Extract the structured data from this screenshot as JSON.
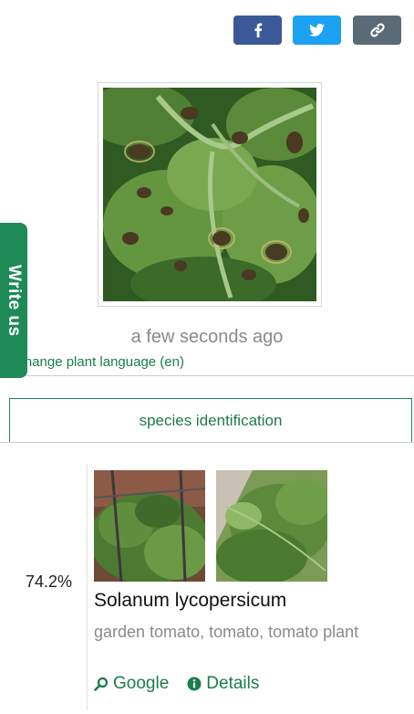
{
  "share": {
    "facebook_icon": "facebook-icon",
    "twitter_icon": "twitter-icon",
    "link_icon": "link-icon"
  },
  "observation": {
    "timestamp": "a few seconds ago",
    "change_language": "Change plant language (en)"
  },
  "feedback_tab": {
    "label": "Write us"
  },
  "tabs": {
    "species_identification": "species identification"
  },
  "results": [
    {
      "score": "74.2%",
      "scientific_name": "Solanum lycopersicum",
      "common_names": "garden tomato, tomato, tomato plant",
      "links": {
        "google": "Google",
        "details": "Details"
      }
    }
  ],
  "colors": {
    "accent": "#1e8a55",
    "facebook": "#3b5998",
    "twitter": "#1da1f2",
    "link": "#5a6a77"
  }
}
